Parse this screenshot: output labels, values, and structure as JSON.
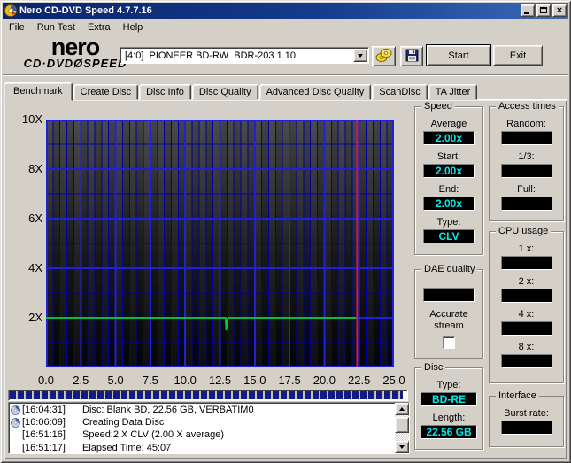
{
  "window": {
    "title": "Nero CD-DVD Speed 4.7.7.16"
  },
  "menu": {
    "items": [
      "File",
      "Run Test",
      "Extra",
      "Help"
    ]
  },
  "toolbar": {
    "logo": {
      "top": "nero",
      "sub_left": "CD·DVD",
      "disc_glyph": "Ø",
      "sub_right": "SPEED"
    },
    "drive_select_value": "[4:0]  PIONEER BD-RW  BDR-203 1.10",
    "start_label": "Start",
    "exit_label": "Exit",
    "icons": [
      "discs-icon",
      "floppy-save-icon"
    ]
  },
  "tabs": [
    {
      "label": "Benchmark",
      "active": true
    },
    {
      "label": "Create Disc",
      "active": false
    },
    {
      "label": "Disc Info",
      "active": false
    },
    {
      "label": "Disc Quality",
      "active": false
    },
    {
      "label": "Advanced Disc Quality",
      "active": false
    },
    {
      "label": "ScanDisc",
      "active": false
    },
    {
      "label": "TA Jitter",
      "active": false
    }
  ],
  "chart_data": {
    "type": "line",
    "xlim": [
      0,
      25
    ],
    "ylim": [
      0,
      10
    ],
    "x_ticks": [
      {
        "label": "0.0",
        "value": 0
      },
      {
        "label": "2.5",
        "value": 2.5
      },
      {
        "label": "5.0",
        "value": 5
      },
      {
        "label": "7.5",
        "value": 7.5
      },
      {
        "label": "10.0",
        "value": 10
      },
      {
        "label": "12.5",
        "value": 12.5
      },
      {
        "label": "15.0",
        "value": 15
      },
      {
        "label": "17.5",
        "value": 17.5
      },
      {
        "label": "20.0",
        "value": 20
      },
      {
        "label": "22.5",
        "value": 22.5
      },
      {
        "label": "25.0",
        "value": 25
      }
    ],
    "y_ticks": [
      {
        "label": "10X",
        "value": 10
      },
      {
        "label": "8X",
        "value": 8
      },
      {
        "label": "6X",
        "value": 6
      },
      {
        "label": "4X",
        "value": 4
      },
      {
        "label": "2X",
        "value": 2
      }
    ],
    "x_minor_step": 0.5,
    "x_major_step": 2.5,
    "y_minor_step": 1,
    "y_major_step": 2,
    "grid_minor_color": "#0000a0",
    "grid_major_color": "#2020dc",
    "bg_top": "#434343",
    "bg_mid": "#181818",
    "bg_bottom": "#040404",
    "series": [
      {
        "name": "write-speed",
        "color": "#00d22c",
        "points": [
          [
            0,
            2
          ],
          [
            12.9,
            2
          ],
          [
            12.95,
            1.5
          ],
          [
            13.05,
            1.95
          ],
          [
            13.1,
            2
          ],
          [
            22.35,
            2
          ]
        ]
      }
    ],
    "end_marker_x": 22.35,
    "end_marker_color": "#d4145a",
    "grid": true,
    "legend_position": "none"
  },
  "progress": {
    "percent": 99
  },
  "panels": {
    "speed": {
      "title": "Speed",
      "rows": [
        {
          "label": "Average",
          "value": "2.00x"
        },
        {
          "label": "Start:",
          "value": "2.00x"
        },
        {
          "label": "End:",
          "value": "2.00x"
        },
        {
          "label": "Type:",
          "value": "CLV"
        }
      ]
    },
    "access_times": {
      "title": "Access times",
      "rows": [
        {
          "label": "Random:",
          "value": ""
        },
        {
          "label": "1/3:",
          "value": ""
        },
        {
          "label": "Full:",
          "value": ""
        }
      ]
    },
    "dae_quality": {
      "title": "DAE quality",
      "value": "",
      "checkbox_label": "Accurate stream",
      "checkbox_checked": false
    },
    "cpu_usage": {
      "title": "CPU usage",
      "rows": [
        {
          "label": "1 x:",
          "value": ""
        },
        {
          "label": "2 x:",
          "value": ""
        },
        {
          "label": "4 x:",
          "value": ""
        },
        {
          "label": "8 x:",
          "value": ""
        }
      ]
    },
    "disc": {
      "title": "Disc",
      "rows": [
        {
          "label": "Type:",
          "value": "BD-RE"
        },
        {
          "label": "Length:",
          "value": "22.56 GB"
        }
      ]
    },
    "interface": {
      "title": "Interface",
      "rows": [
        {
          "label": "Burst rate:",
          "value": ""
        }
      ]
    }
  },
  "log": {
    "entries": [
      {
        "icon": true,
        "time": "[16:04:31]",
        "text": "Disc: Blank BD, 22.56 GB, VERBATIM0"
      },
      {
        "icon": true,
        "time": "[16:06:09]",
        "text": "Creating Data Disc"
      },
      {
        "icon": false,
        "time": "[16:51:16]",
        "text": "Speed:2 X CLV (2.00 X average)"
      },
      {
        "icon": false,
        "time": "[16:51:17]",
        "text": "Elapsed Time: 45:07"
      }
    ]
  }
}
